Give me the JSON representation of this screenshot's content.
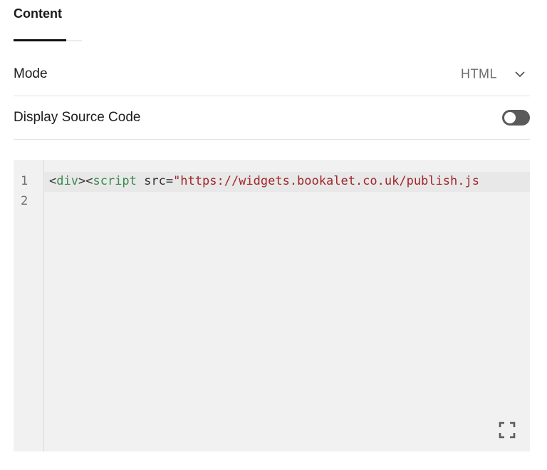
{
  "tabs": [
    {
      "label": "Content",
      "active": true
    }
  ],
  "rows": {
    "mode": {
      "label": "Mode",
      "value": "HTML",
      "icon": "chevron-down-icon"
    },
    "display_source": {
      "label": "Display Source Code",
      "toggle_on": false
    }
  },
  "editor": {
    "line_numbers": [
      "1",
      "2"
    ],
    "tokens": {
      "open_lt": "<",
      "div": "div",
      "gt_lt": "><",
      "script": "script",
      "attr": " src=",
      "string": "\"https://widgets.bookalet.co.uk/publish.js"
    },
    "expand_icon": "fullscreen-icon"
  },
  "colors": {
    "tag": "#3a8a4e",
    "string": "#a2262a",
    "toggle_track": "#5a5a5a"
  }
}
